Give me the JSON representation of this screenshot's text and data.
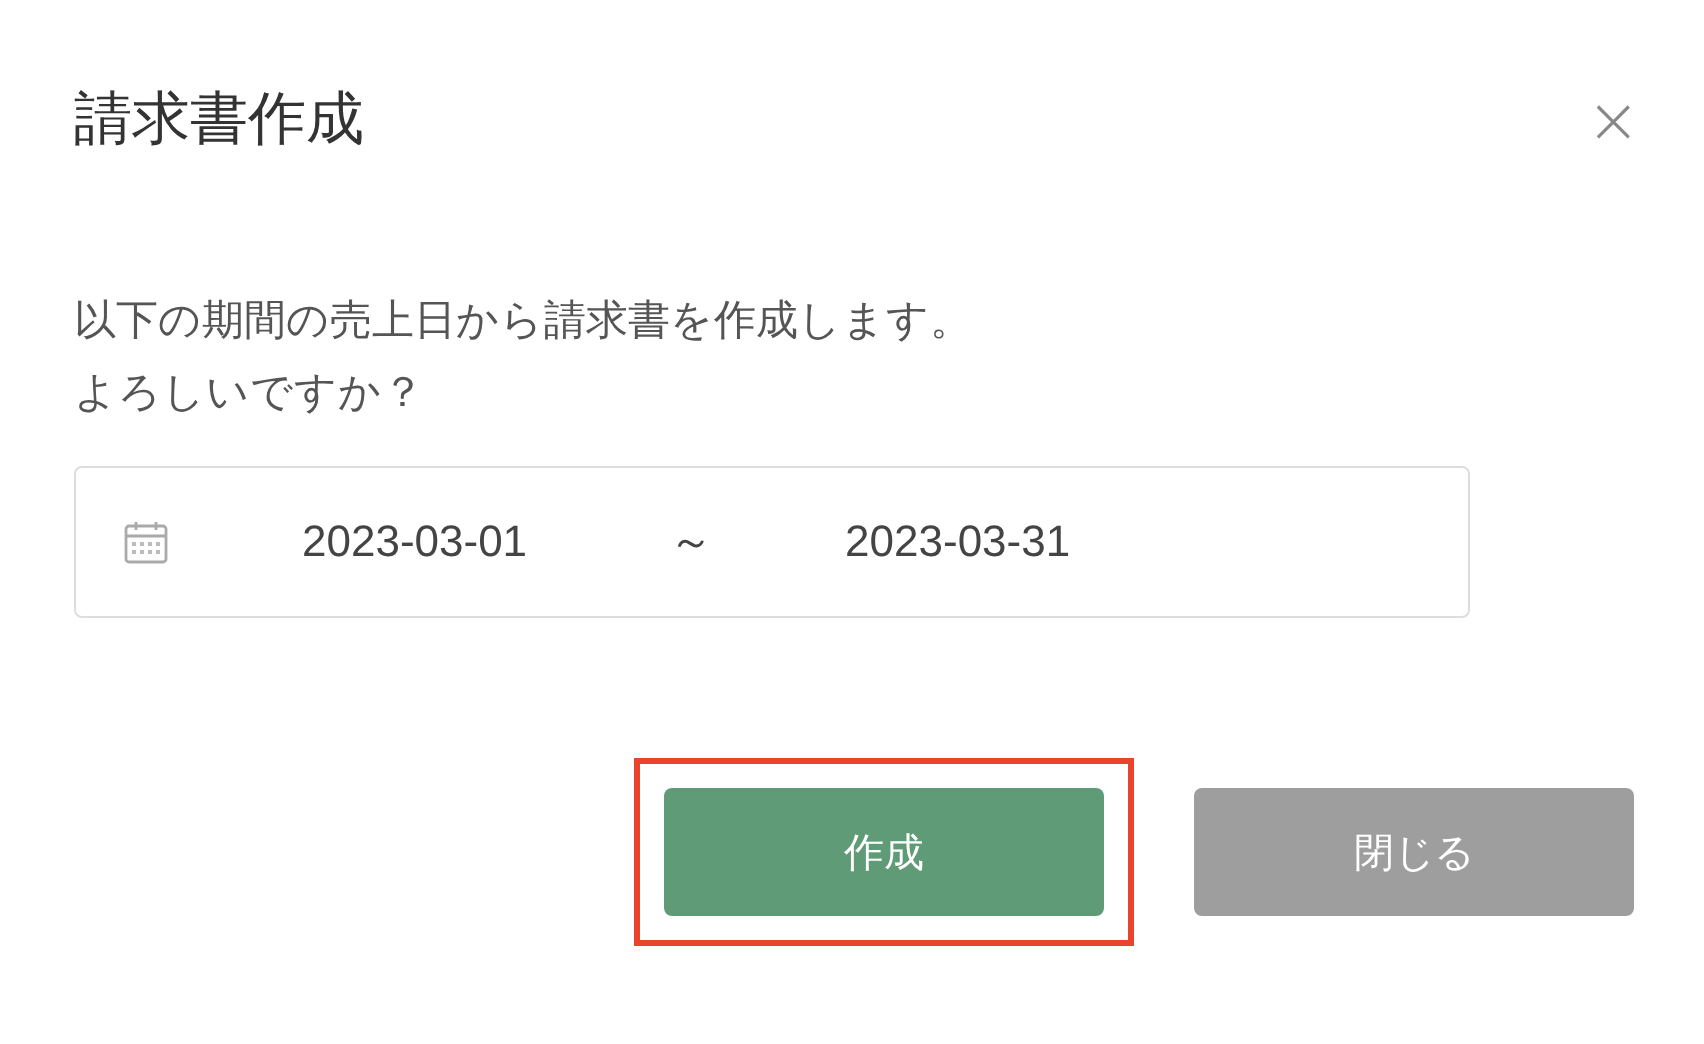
{
  "dialog": {
    "title": "請求書作成",
    "close": "×"
  },
  "message": [
    "以下の期間の売上日から請求書を作成します。",
    "よろしいですか？"
  ],
  "date_range": {
    "start": "2023-03-01",
    "separator": "～",
    "end": "2023-03-31"
  },
  "buttons": [
    {
      "label": "作成",
      "kind": "primary",
      "highlighted": true
    },
    {
      "label": "閉じる",
      "kind": "secondary",
      "highlighted": false
    }
  ]
}
